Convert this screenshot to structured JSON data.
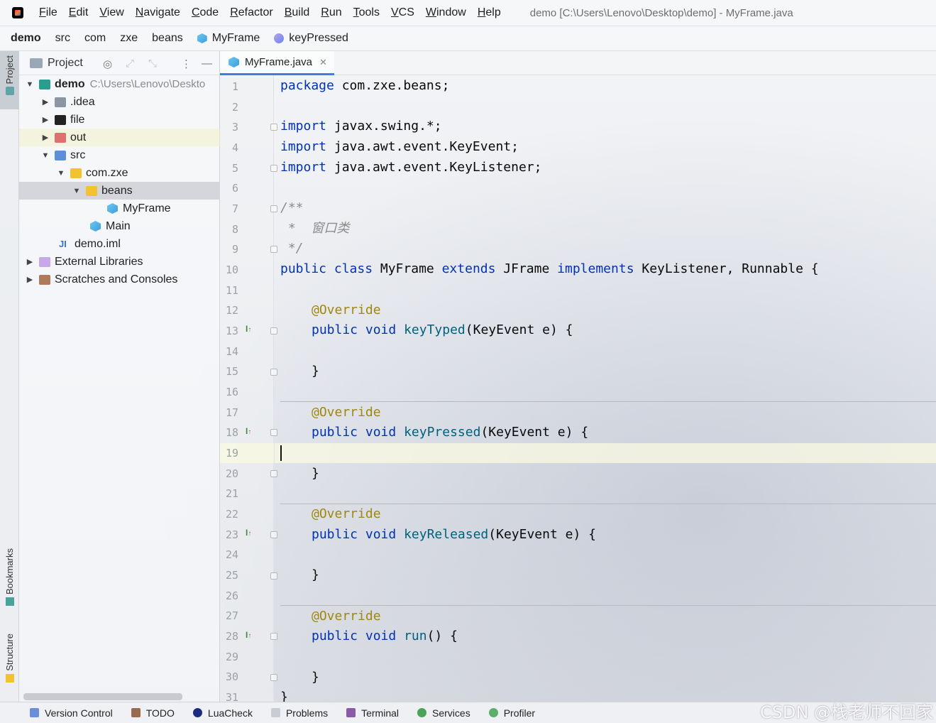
{
  "menubar": {
    "items": [
      "File",
      "Edit",
      "View",
      "Navigate",
      "Code",
      "Refactor",
      "Build",
      "Run",
      "Tools",
      "VCS",
      "Window",
      "Help"
    ],
    "window_title": "demo [C:\\Users\\Lenovo\\Desktop\\demo] - MyFrame.java"
  },
  "breadcrumb": [
    "demo",
    "src",
    "com",
    "zxe",
    "beans",
    "MyFrame",
    "keyPressed"
  ],
  "left_strip": {
    "project": "Project",
    "bookmarks": "Bookmarks",
    "structure": "Structure"
  },
  "project_panel": {
    "title": "Project",
    "tree": [
      {
        "label": "demo",
        "path": "C:\\Users\\Lenovo\\Deskto",
        "icon": "module-folder-icon"
      },
      {
        "label": ".idea",
        "icon": "folder-icon"
      },
      {
        "label": "file",
        "icon": "folder-icon"
      },
      {
        "label": "out",
        "icon": "excluded-folder-icon"
      },
      {
        "label": "src",
        "icon": "source-folder-icon"
      },
      {
        "label": "com.zxe",
        "icon": "package-icon"
      },
      {
        "label": "beans",
        "icon": "package-icon"
      },
      {
        "label": "MyFrame",
        "icon": "java-class-icon"
      },
      {
        "label": "Main",
        "icon": "java-class-icon"
      },
      {
        "label": "demo.iml",
        "icon": "iml-file-icon"
      },
      {
        "label": "External Libraries",
        "icon": "libraries-icon"
      },
      {
        "label": "Scratches and Consoles",
        "icon": "scratches-icon"
      }
    ]
  },
  "editor": {
    "tab_label": "MyFrame.java",
    "line_numbers": [
      "1",
      "2",
      "3",
      "4",
      "5",
      "6",
      "7",
      "8",
      "9",
      "10",
      "11",
      "12",
      "13",
      "14",
      "15",
      "16",
      "17",
      "18",
      "19",
      "20",
      "21",
      "22",
      "23",
      "24",
      "25",
      "26",
      "27",
      "28",
      "29",
      "30",
      "31"
    ],
    "code": {
      "l1_kw": "package",
      "l1_rest": " com.zxe.beans;",
      "l3_kw": "import",
      "l3_rest": " javax.swing.*;",
      "l4_kw": "import",
      "l4_rest": " java.awt.event.KeyEvent;",
      "l5_kw": "import",
      "l5_rest": " java.awt.event.KeyListener;",
      "l7": "/**",
      "l8": " *  窗口类",
      "l9": " */",
      "l10_kw1": "public class",
      "l10_name": " MyFrame ",
      "l10_kw2": "extends",
      "l10_mid": " JFrame ",
      "l10_kw3": "implements",
      "l10_rest": " KeyListener, Runnable {",
      "annotation": "@Override",
      "pv": "public void",
      "l13_fn": "keyTyped",
      "l13_rest": "(KeyEvent e) {",
      "l18_fn": "keyPressed",
      "l18_rest": "(KeyEvent e) {",
      "l23_fn": "keyReleased",
      "l23_rest": "(KeyEvent e) {",
      "l28_fn": "run",
      "l28_rest": "() {",
      "close_brace": "}"
    }
  },
  "statusbar": {
    "items": [
      "Version Control",
      "TODO",
      "LuaCheck",
      "Problems",
      "Terminal",
      "Services",
      "Profiler"
    ]
  },
  "watermark": "CSDN @栈老师不回家",
  "colors": {
    "keyword": "#0033b3",
    "annotation": "#9e880d",
    "comment": "#8c8c8c",
    "method": "#00627a",
    "tab_accent": "#3d7fd9"
  }
}
